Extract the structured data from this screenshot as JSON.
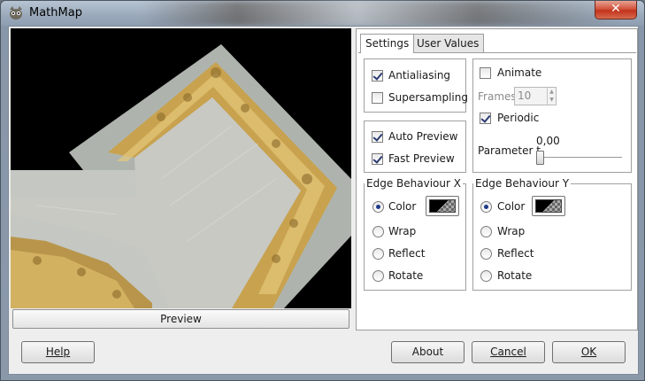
{
  "window": {
    "title": "MathMap",
    "close_label": "✕"
  },
  "preview": {
    "button_label": "Preview"
  },
  "tabs": [
    {
      "label": "Settings"
    },
    {
      "label": "User Values"
    }
  ],
  "settings": {
    "antialiasing": {
      "label": "Antialiasing",
      "checked": true
    },
    "supersampling": {
      "label": "Supersampling",
      "checked": false
    },
    "auto_preview": {
      "label": "Auto Preview",
      "checked": true
    },
    "fast_preview": {
      "label": "Fast Preview",
      "checked": true
    },
    "animate": {
      "label": "Animate",
      "checked": false
    },
    "frames": {
      "label": "Frames",
      "value": "10"
    },
    "periodic": {
      "label": "Periodic",
      "checked": true
    },
    "parameter_t": {
      "label": "Parameter t",
      "value": "0,00",
      "fraction": 0.0
    }
  },
  "edge_x": {
    "title": "Edge Behaviour X",
    "options": [
      "Color",
      "Wrap",
      "Reflect",
      "Rotate"
    ],
    "selected": "Color"
  },
  "edge_y": {
    "title": "Edge Behaviour Y",
    "options": [
      "Color",
      "Wrap",
      "Reflect",
      "Rotate"
    ],
    "selected": "Color"
  },
  "buttons": {
    "help": "Help",
    "about": "About",
    "cancel": "Cancel",
    "ok": "OK"
  },
  "colors": {
    "frame_gold": "#c8a24e",
    "canvas_grey": "#b8bdb7",
    "background": "#000000"
  }
}
